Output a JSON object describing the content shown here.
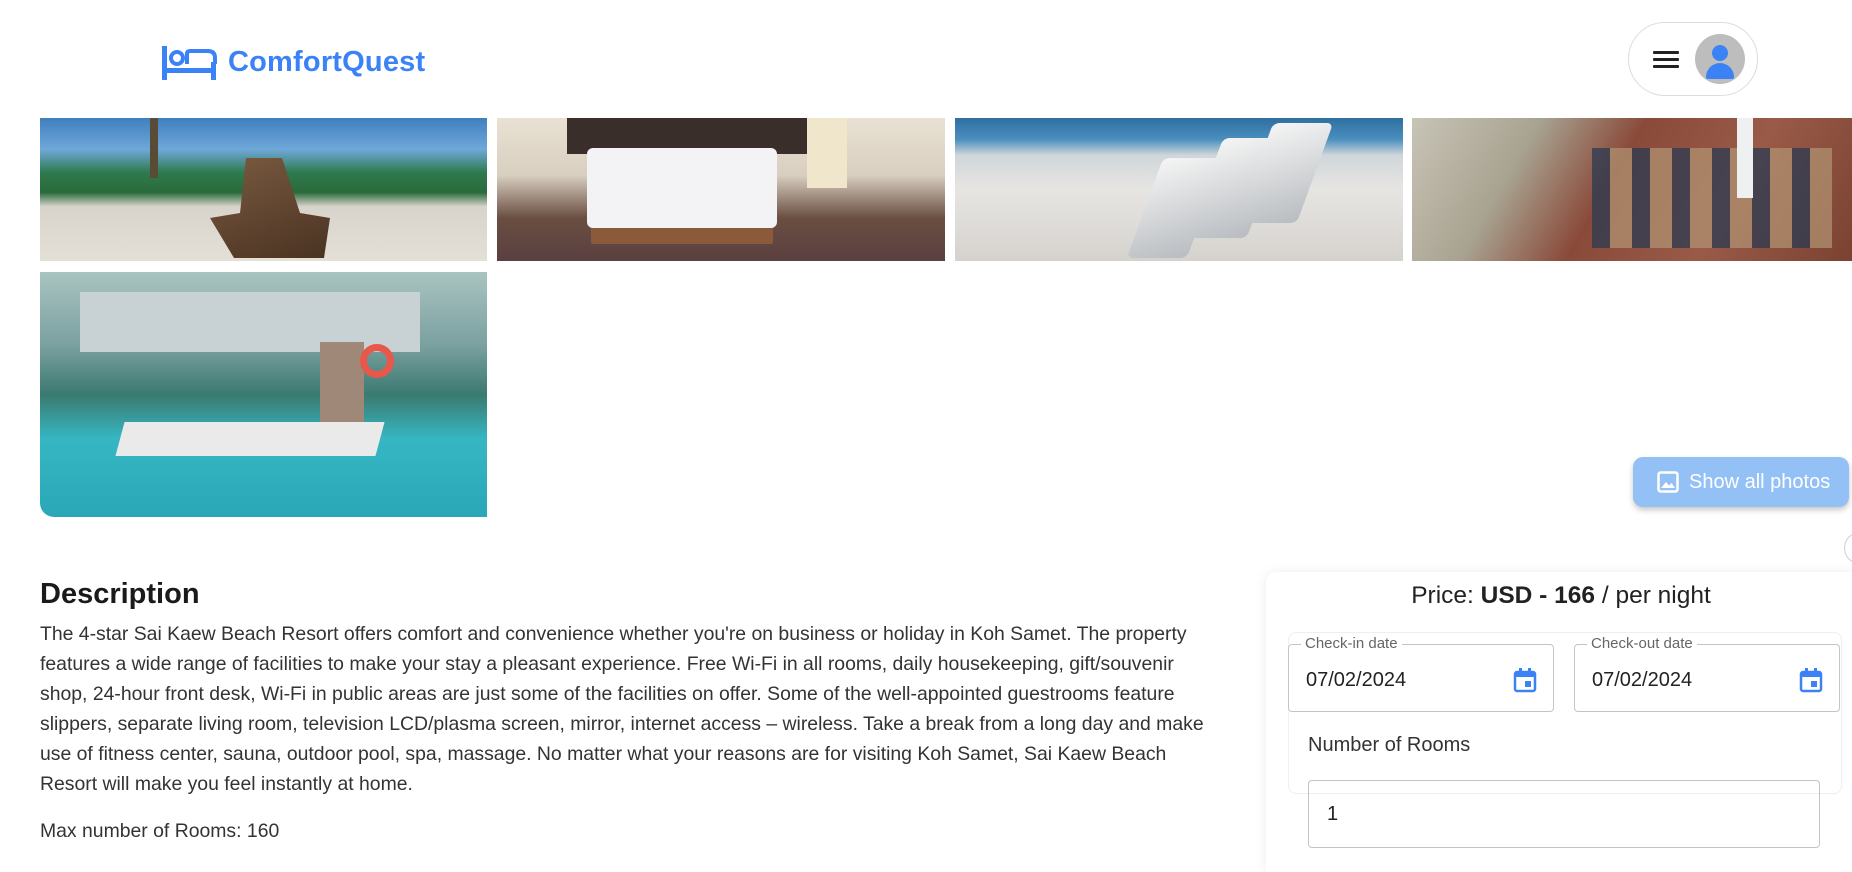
{
  "header": {
    "brand_name": "ComfortQuest",
    "brand_icon": "bed-icon",
    "menu_icon": "hamburger-icon",
    "avatar_icon": "person-icon"
  },
  "gallery": {
    "photos": [
      {
        "name": "beach-chairs-photo"
      },
      {
        "name": "hotel-room-photo"
      },
      {
        "name": "beach-loungers-photo"
      },
      {
        "name": "restaurant-terrace-photo"
      },
      {
        "name": "pool-bar-photo"
      }
    ],
    "show_all_label": "Show all photos"
  },
  "description": {
    "title": "Description",
    "text": "The 4-star Sai Kaew Beach Resort offers comfort and convenience whether you're on business or holiday in Koh Samet. The property features a wide range of facilities to make your stay a pleasant experience. Free Wi-Fi in all rooms, daily housekeeping, gift/souvenir shop, 24-hour front desk, Wi-Fi in public areas are just some of the facilities on offer. Some of the well-appointed guestrooms feature slippers, separate living room, television LCD/plasma screen, mirror, internet access – wireless. Take a break from a long day and make use of fitness center, sauna, outdoor pool, spa, massage. No matter what your reasons are for visiting Koh Samet, Sai Kaew Beach Resort will make you feel instantly at home.",
    "max_rooms": "Max number of Rooms: 160"
  },
  "booking": {
    "price_prefix": "Price: ",
    "price_value": "USD - 166",
    "price_suffix": " / per night",
    "checkin_label": "Check-in date",
    "checkin_value": "07/02/2024",
    "checkout_label": "Check-out date",
    "checkout_value": "07/02/2024",
    "rooms_label": "Number of Rooms",
    "rooms_value": "1"
  },
  "colors": {
    "accent": "#3b82f6",
    "show_photos_bg": "#93c0f5"
  }
}
